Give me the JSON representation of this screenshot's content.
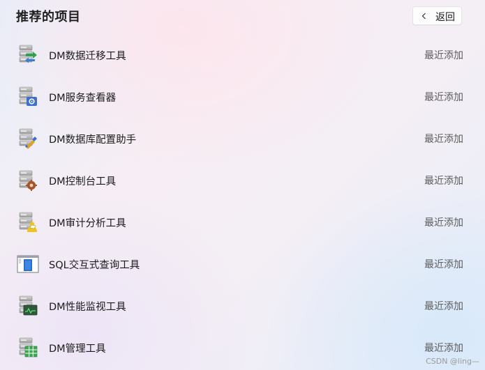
{
  "header": {
    "title": "推荐的项目",
    "back_label": "返回",
    "back_icon": "chevron-left-icon"
  },
  "items": [
    {
      "name": "DM数据迁移工具",
      "status": "最近添加",
      "icon": "data-migration-icon"
    },
    {
      "name": "DM服务查看器",
      "status": "最近添加",
      "icon": "service-viewer-icon"
    },
    {
      "name": "DM数据库配置助手",
      "status": "最近添加",
      "icon": "db-config-assistant-icon"
    },
    {
      "name": "DM控制台工具",
      "status": "最近添加",
      "icon": "console-tool-icon"
    },
    {
      "name": "DM审计分析工具",
      "status": "最近添加",
      "icon": "audit-analysis-icon"
    },
    {
      "name": "SQL交互式查询工具",
      "status": "最近添加",
      "icon": "sql-query-icon"
    },
    {
      "name": "DM性能监视工具",
      "status": "最近添加",
      "icon": "performance-monitor-icon"
    },
    {
      "name": "DM管理工具",
      "status": "最近添加",
      "icon": "management-tool-icon"
    }
  ],
  "watermark": "CSDN @ling—"
}
